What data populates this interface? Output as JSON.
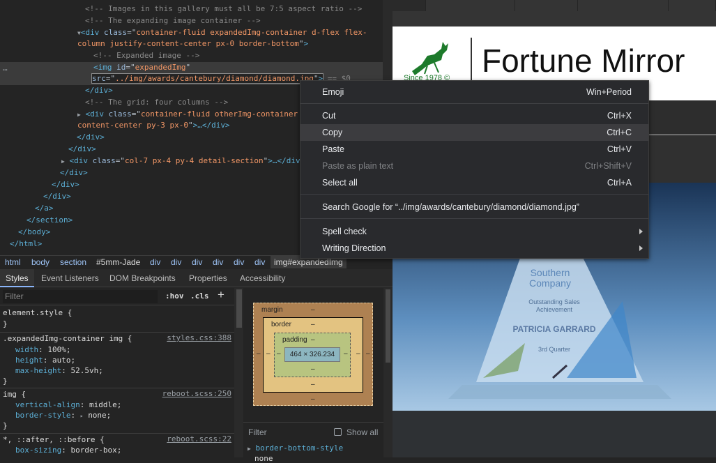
{
  "elements_panel": {
    "lines": [
      {
        "t": "cm",
        "text": "<!-- Images in this gallery must all be 7:5 aspect ratio -->"
      },
      {
        "t": "cm",
        "text": "<!-- The expanding image container -->"
      },
      {
        "t": "div_open",
        "tag": "div",
        "attr": "class",
        "value": "container-fluid expandedImg-container d-flex flex-",
        "cont": "column justify-content-center px-0 border-bottom"
      },
      {
        "t": "cm",
        "text": "<!-- Expanded image -->"
      },
      {
        "t": "img",
        "tag": "img",
        "attr": "id",
        "value": "expandedImg",
        "src_attr": "src",
        "src_value": "../img/awards/cantebury/diamond/diamond.jpg",
        "tail": "== $0"
      },
      {
        "text": "</div>"
      },
      {
        "t": "cm",
        "text": "<!-- The grid: four columns -->"
      },
      {
        "tag": "div",
        "attr": "class",
        "value": "container-fluid otherImg-container",
        "cont": "content-center py-3 px-0",
        "cont_tail": ">…</div>"
      },
      {
        "text": "</div>"
      },
      {
        "text": "</div>"
      },
      {
        "tag": "div",
        "attr": "class",
        "value": "col-7 px-4 py-4 detail-section",
        "tail": ">…</div>"
      },
      {
        "text": "</div>"
      },
      {
        "text": "</div>"
      },
      {
        "text": "</div>"
      },
      {
        "text": "</a>"
      },
      {
        "text": "</section>"
      },
      {
        "text": "</body>"
      },
      {
        "text": "</html>"
      }
    ],
    "dots": "…"
  },
  "breadcrumbs": [
    "html",
    "body",
    "section",
    "#5mm-Jade",
    "div",
    "div",
    "div",
    "div",
    "div",
    "div",
    "img#expandedImg"
  ],
  "tabs": [
    "Styles",
    "Event Listeners",
    "DOM Breakpoints",
    "Properties",
    "Accessibility"
  ],
  "styles": {
    "filter_placeholder": "Filter",
    "hov": ":hov",
    "cls": ".cls",
    "plus": "+",
    "rules": [
      {
        "selector": "element.style {",
        "source": "",
        "props": [],
        "close": "}"
      },
      {
        "selector": ".expandedImg-container img {",
        "source": "styles.css:388",
        "props": [
          {
            "p": "width",
            "v": "100%;"
          },
          {
            "p": "height",
            "v": "auto;"
          },
          {
            "p": "max-height",
            "v": "52.5vh;"
          }
        ],
        "close": "}"
      },
      {
        "selector": "img {",
        "source": "reboot.scss:250",
        "props": [
          {
            "p": "vertical-align",
            "v": "middle;"
          },
          {
            "p": "border-style",
            "v": "none;",
            "arrow": "▸"
          }
        ],
        "close": "}"
      },
      {
        "selector": "*, ::after, ::before {",
        "source": "reboot.scss:22",
        "props": [
          {
            "p": "box-sizing",
            "v": "border-box;"
          }
        ],
        "close": ""
      }
    ]
  },
  "box_model": {
    "margin_label": "margin",
    "border_label": "border",
    "padding_label": "padding",
    "dash": "–",
    "content": "464 × 326.234"
  },
  "computed": {
    "filter": "Filter",
    "show_all": "Show all",
    "first_prop": "border-bottom-style",
    "first_val": "none"
  },
  "page": {
    "since": "Since 1978 ©",
    "brand": "Fortune Mirror",
    "award_lines": [
      "Southern",
      "Company",
      "Outstanding Sales",
      "Achievement",
      "PATRICIA GARRARD",
      "3rd Quarter"
    ]
  },
  "context_menu": {
    "items": [
      {
        "label": "Emoji",
        "key": "Win+Period"
      },
      {
        "label": "Cut",
        "key": "Ctrl+X"
      },
      {
        "label": "Copy",
        "key": "Ctrl+C"
      },
      {
        "label": "Paste",
        "key": "Ctrl+V"
      },
      {
        "label": "Paste as plain text",
        "key": "Ctrl+Shift+V"
      },
      {
        "label": "Select all",
        "key": "Ctrl+A"
      },
      {
        "label": "Search Google for “../img/awards/cantebury/diamond/diamond.jpg”",
        "key": ""
      },
      {
        "label": "Spell check",
        "key": ""
      },
      {
        "label": "Writing Direction",
        "key": ""
      }
    ]
  },
  "colors": {
    "accent": "#8ab4f8",
    "tag": "#5db0d7",
    "attr_value": "#f29766",
    "menu_bg": "#292a2d"
  }
}
